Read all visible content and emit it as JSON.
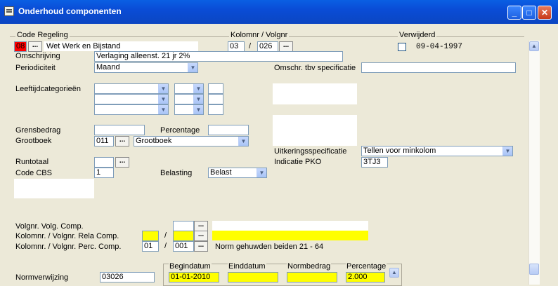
{
  "window": {
    "title": "Onderhoud componenten"
  },
  "code_regeling": {
    "label": "Code Regeling",
    "code": "08",
    "name": "Wet Werk en Bijstand"
  },
  "kolomnr": {
    "label": "Kolomnr / Volgnr",
    "kolom": "03",
    "sep": "/",
    "volg": "026"
  },
  "verwijderd": {
    "label": "Verwijderd",
    "date": "09-04-1997"
  },
  "omschrijving": {
    "label": "Omschrijving",
    "value": "Verlaging alleenst. 21 jr 2%"
  },
  "periodiciteit": {
    "label": "Periodiciteit",
    "value": "Maand"
  },
  "omschr_spec": {
    "label": "Omschr. tbv specificatie",
    "value": ""
  },
  "leeftijd": {
    "label": "Leeftijdcategorieën"
  },
  "grensbedrag": {
    "label": "Grensbedrag",
    "value": ""
  },
  "percentage_field": {
    "label": "Percentage",
    "value": ""
  },
  "grootboek": {
    "label": "Grootboek",
    "code": "011",
    "value": "Grootboek"
  },
  "uitkering": {
    "label": "Uitkeringsspecificatie",
    "value": "Tellen voor minkolom"
  },
  "pko": {
    "label": "Indicatie PKO",
    "value": "3TJ3"
  },
  "runtotaal": {
    "label": "Runtotaal",
    "value": ""
  },
  "code_cbs": {
    "label": "Code CBS",
    "value": "1"
  },
  "belasting": {
    "label": "Belasting",
    "value": "Belast"
  },
  "volg_comp": {
    "label": "Volgnr. Volg. Comp."
  },
  "rela_comp": {
    "label": "Kolomnr. / Volgnr. Rela Comp.",
    "sep": "/"
  },
  "perc_comp": {
    "label": "Kolomnr. / Volgnr. Perc. Comp.",
    "kolom": "01",
    "sep": "/",
    "volg": "001",
    "desc": "Norm gehuwden  beiden 21 - 64"
  },
  "norm": {
    "label": "Normverwijzing",
    "value": "03026"
  },
  "grid": {
    "headers": {
      "begin": "Begindatum",
      "eind": "Einddatum",
      "normbedrag": "Normbedrag",
      "percentage": "Percentage"
    },
    "row": {
      "begin": "01-01-2010",
      "eind": "",
      "normbedrag": "",
      "percentage": "2.000"
    }
  },
  "ellipsis": "...",
  "icons": {
    "dropdown": "chevron-down-icon",
    "scroll_up": "arrow-up-icon",
    "minimize": "minimize-icon",
    "maximize": "maximize-icon",
    "close": "close-icon"
  }
}
